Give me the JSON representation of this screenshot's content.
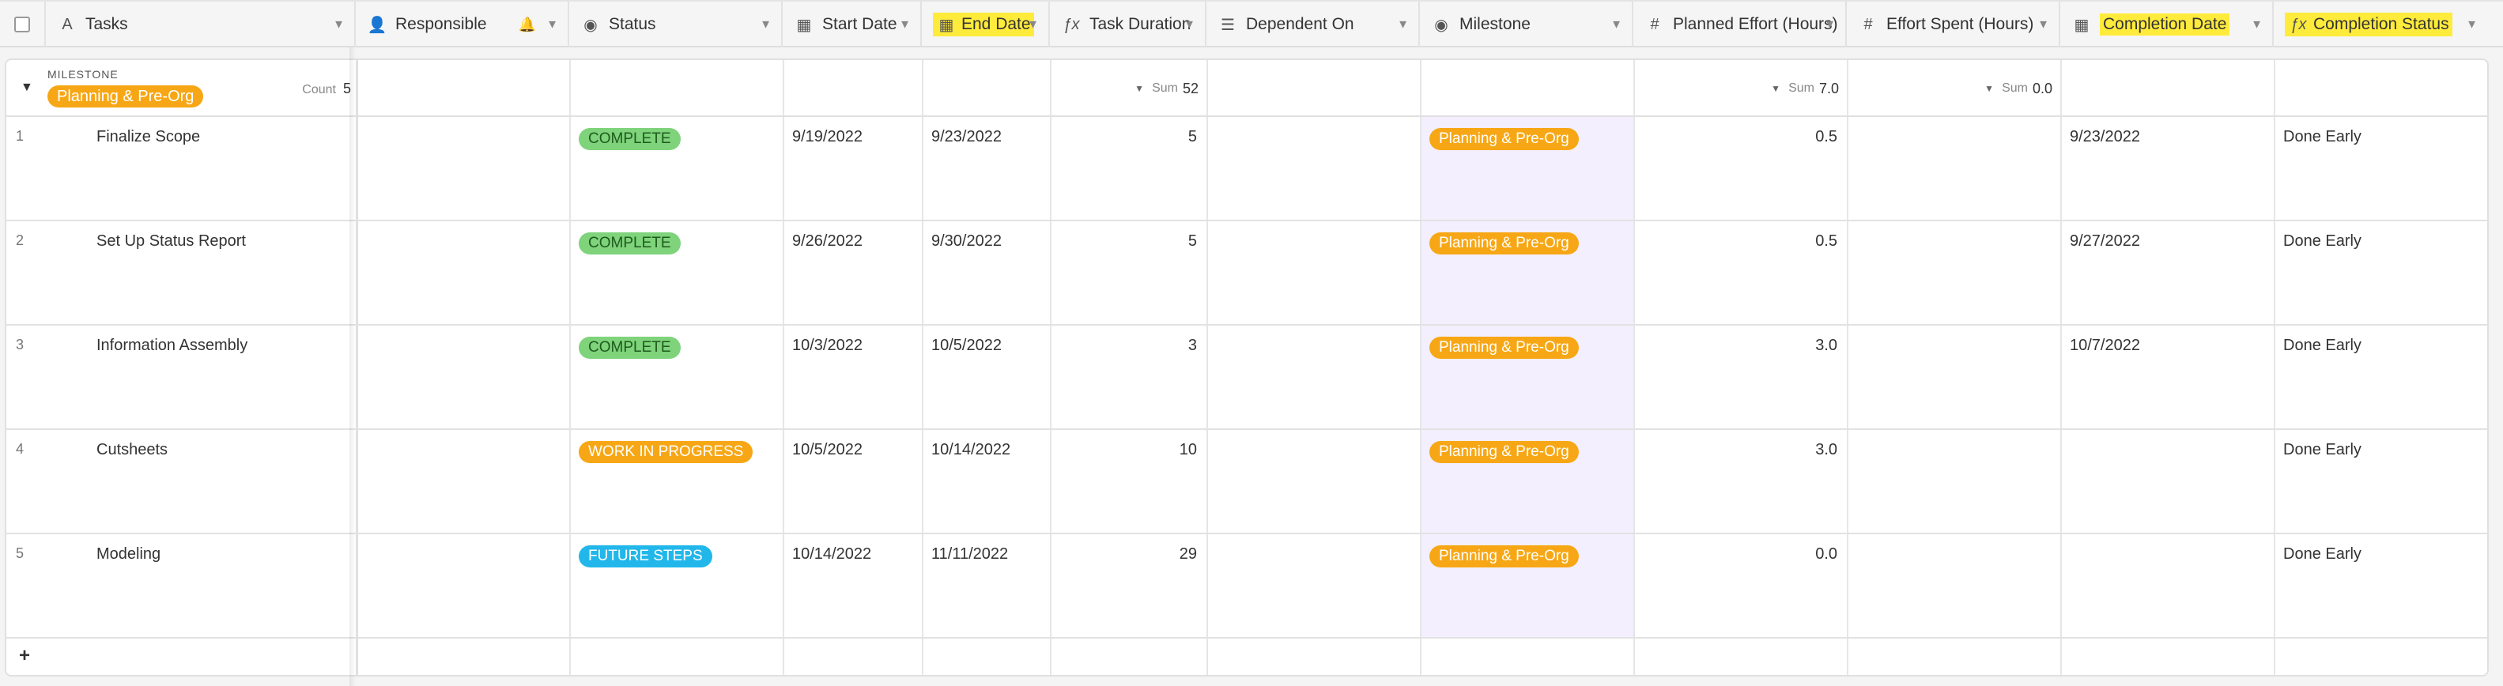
{
  "columns": [
    {
      "label": "Tasks",
      "icon": "text-icon",
      "icon_glyph": "A"
    },
    {
      "label": "Responsible",
      "icon": "user-icon",
      "icon_glyph": "👤"
    },
    {
      "label": "Status",
      "icon": "single-select-icon",
      "icon_glyph": "◉"
    },
    {
      "label": "Start Date",
      "icon": "calendar-icon",
      "icon_glyph": "▦"
    },
    {
      "label": "End Date",
      "icon": "calendar-icon",
      "icon_glyph": "▦"
    },
    {
      "label": "Task Duration",
      "icon": "formula-icon",
      "icon_glyph": "ƒx"
    },
    {
      "label": "Dependent On",
      "icon": "link-icon",
      "icon_glyph": "☰"
    },
    {
      "label": "Milestone",
      "icon": "single-select-icon",
      "icon_glyph": "◉"
    },
    {
      "label": "Planned Effort (Hours)",
      "icon": "number-icon",
      "icon_glyph": "#"
    },
    {
      "label": "Effort Spent (Hours)",
      "icon": "number-icon",
      "icon_glyph": "#"
    },
    {
      "label": "Completion Date",
      "icon": "calendar-icon",
      "icon_glyph": "▦"
    },
    {
      "label": "Completion Status",
      "icon": "formula-icon",
      "icon_glyph": "ƒx"
    }
  ],
  "group": {
    "field_label": "MILESTONE",
    "value": "Planning & Pre-Org",
    "count_label": "Count",
    "count": "5",
    "sum_label": "Sum",
    "duration_sum": "52",
    "planned_sum": "7.0",
    "spent_sum": "0.0"
  },
  "rows": [
    {
      "n": "1",
      "task": "Finalize Scope",
      "status": "COMPLETE",
      "start": "9/19/2022",
      "end": "9/23/2022",
      "duration": "5",
      "milestone": "Planning & Pre-Org",
      "planned": "0.5",
      "completion_date": "9/23/2022",
      "completion_status": "Done Early"
    },
    {
      "n": "2",
      "task": "Set Up Status Report",
      "status": "COMPLETE",
      "start": "9/26/2022",
      "end": "9/30/2022",
      "duration": "5",
      "milestone": "Planning & Pre-Org",
      "planned": "0.5",
      "completion_date": "9/27/2022",
      "completion_status": "Done Early"
    },
    {
      "n": "3",
      "task": "Information Assembly",
      "status": "COMPLETE",
      "start": "10/3/2022",
      "end": "10/5/2022",
      "duration": "3",
      "milestone": "Planning & Pre-Org",
      "planned": "3.0",
      "completion_date": "10/7/2022",
      "completion_status": "Done Early"
    },
    {
      "n": "4",
      "task": "Cutsheets",
      "status": "WORK IN PROGRESS",
      "start": "10/5/2022",
      "end": "10/14/2022",
      "duration": "10",
      "milestone": "Planning & Pre-Org",
      "planned": "3.0",
      "completion_date": "",
      "completion_status": "Done Early"
    },
    {
      "n": "5",
      "task": "Modeling",
      "status": "FUTURE STEPS",
      "start": "10/14/2022",
      "end": "11/11/2022",
      "duration": "29",
      "milestone": "Planning & Pre-Org",
      "planned": "0.0",
      "completion_date": "",
      "completion_status": "Done Early"
    }
  ],
  "add_row_glyph": "+",
  "colors": {
    "complete": "#7ed37b",
    "work_in_progress": "#f7a715",
    "future_steps": "#22b7ea",
    "milestone": "#f7a715",
    "highlight": "#ffeb3b"
  }
}
